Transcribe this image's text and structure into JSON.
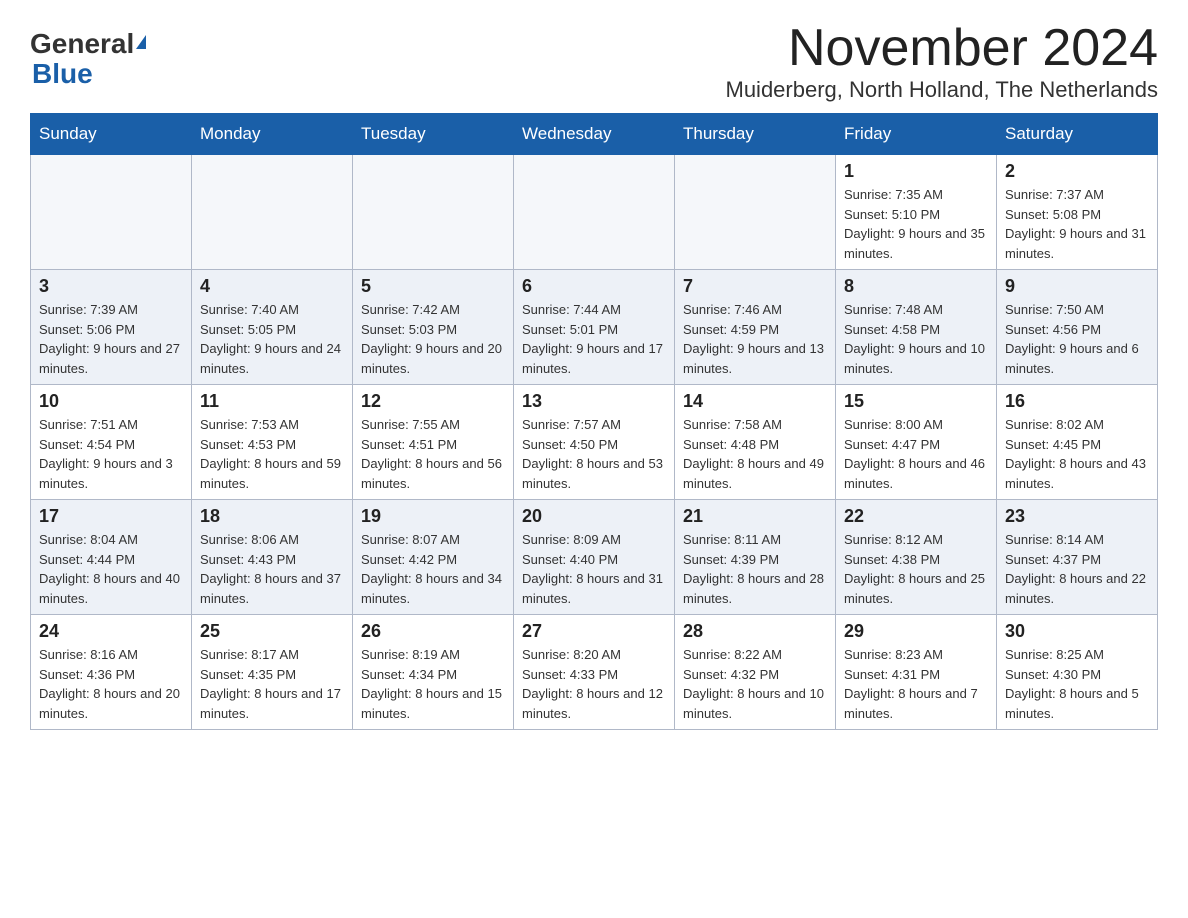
{
  "header": {
    "logo_general": "General",
    "logo_blue": "Blue",
    "month_title": "November 2024",
    "subtitle": "Muiderberg, North Holland, The Netherlands"
  },
  "weekdays": [
    "Sunday",
    "Monday",
    "Tuesday",
    "Wednesday",
    "Thursday",
    "Friday",
    "Saturday"
  ],
  "weeks": [
    [
      {
        "day": "",
        "info": ""
      },
      {
        "day": "",
        "info": ""
      },
      {
        "day": "",
        "info": ""
      },
      {
        "day": "",
        "info": ""
      },
      {
        "day": "",
        "info": ""
      },
      {
        "day": "1",
        "info": "Sunrise: 7:35 AM\nSunset: 5:10 PM\nDaylight: 9 hours and 35 minutes."
      },
      {
        "day": "2",
        "info": "Sunrise: 7:37 AM\nSunset: 5:08 PM\nDaylight: 9 hours and 31 minutes."
      }
    ],
    [
      {
        "day": "3",
        "info": "Sunrise: 7:39 AM\nSunset: 5:06 PM\nDaylight: 9 hours and 27 minutes."
      },
      {
        "day": "4",
        "info": "Sunrise: 7:40 AM\nSunset: 5:05 PM\nDaylight: 9 hours and 24 minutes."
      },
      {
        "day": "5",
        "info": "Sunrise: 7:42 AM\nSunset: 5:03 PM\nDaylight: 9 hours and 20 minutes."
      },
      {
        "day": "6",
        "info": "Sunrise: 7:44 AM\nSunset: 5:01 PM\nDaylight: 9 hours and 17 minutes."
      },
      {
        "day": "7",
        "info": "Sunrise: 7:46 AM\nSunset: 4:59 PM\nDaylight: 9 hours and 13 minutes."
      },
      {
        "day": "8",
        "info": "Sunrise: 7:48 AM\nSunset: 4:58 PM\nDaylight: 9 hours and 10 minutes."
      },
      {
        "day": "9",
        "info": "Sunrise: 7:50 AM\nSunset: 4:56 PM\nDaylight: 9 hours and 6 minutes."
      }
    ],
    [
      {
        "day": "10",
        "info": "Sunrise: 7:51 AM\nSunset: 4:54 PM\nDaylight: 9 hours and 3 minutes."
      },
      {
        "day": "11",
        "info": "Sunrise: 7:53 AM\nSunset: 4:53 PM\nDaylight: 8 hours and 59 minutes."
      },
      {
        "day": "12",
        "info": "Sunrise: 7:55 AM\nSunset: 4:51 PM\nDaylight: 8 hours and 56 minutes."
      },
      {
        "day": "13",
        "info": "Sunrise: 7:57 AM\nSunset: 4:50 PM\nDaylight: 8 hours and 53 minutes."
      },
      {
        "day": "14",
        "info": "Sunrise: 7:58 AM\nSunset: 4:48 PM\nDaylight: 8 hours and 49 minutes."
      },
      {
        "day": "15",
        "info": "Sunrise: 8:00 AM\nSunset: 4:47 PM\nDaylight: 8 hours and 46 minutes."
      },
      {
        "day": "16",
        "info": "Sunrise: 8:02 AM\nSunset: 4:45 PM\nDaylight: 8 hours and 43 minutes."
      }
    ],
    [
      {
        "day": "17",
        "info": "Sunrise: 8:04 AM\nSunset: 4:44 PM\nDaylight: 8 hours and 40 minutes."
      },
      {
        "day": "18",
        "info": "Sunrise: 8:06 AM\nSunset: 4:43 PM\nDaylight: 8 hours and 37 minutes."
      },
      {
        "day": "19",
        "info": "Sunrise: 8:07 AM\nSunset: 4:42 PM\nDaylight: 8 hours and 34 minutes."
      },
      {
        "day": "20",
        "info": "Sunrise: 8:09 AM\nSunset: 4:40 PM\nDaylight: 8 hours and 31 minutes."
      },
      {
        "day": "21",
        "info": "Sunrise: 8:11 AM\nSunset: 4:39 PM\nDaylight: 8 hours and 28 minutes."
      },
      {
        "day": "22",
        "info": "Sunrise: 8:12 AM\nSunset: 4:38 PM\nDaylight: 8 hours and 25 minutes."
      },
      {
        "day": "23",
        "info": "Sunrise: 8:14 AM\nSunset: 4:37 PM\nDaylight: 8 hours and 22 minutes."
      }
    ],
    [
      {
        "day": "24",
        "info": "Sunrise: 8:16 AM\nSunset: 4:36 PM\nDaylight: 8 hours and 20 minutes."
      },
      {
        "day": "25",
        "info": "Sunrise: 8:17 AM\nSunset: 4:35 PM\nDaylight: 8 hours and 17 minutes."
      },
      {
        "day": "26",
        "info": "Sunrise: 8:19 AM\nSunset: 4:34 PM\nDaylight: 8 hours and 15 minutes."
      },
      {
        "day": "27",
        "info": "Sunrise: 8:20 AM\nSunset: 4:33 PM\nDaylight: 8 hours and 12 minutes."
      },
      {
        "day": "28",
        "info": "Sunrise: 8:22 AM\nSunset: 4:32 PM\nDaylight: 8 hours and 10 minutes."
      },
      {
        "day": "29",
        "info": "Sunrise: 8:23 AM\nSunset: 4:31 PM\nDaylight: 8 hours and 7 minutes."
      },
      {
        "day": "30",
        "info": "Sunrise: 8:25 AM\nSunset: 4:30 PM\nDaylight: 8 hours and 5 minutes."
      }
    ]
  ]
}
